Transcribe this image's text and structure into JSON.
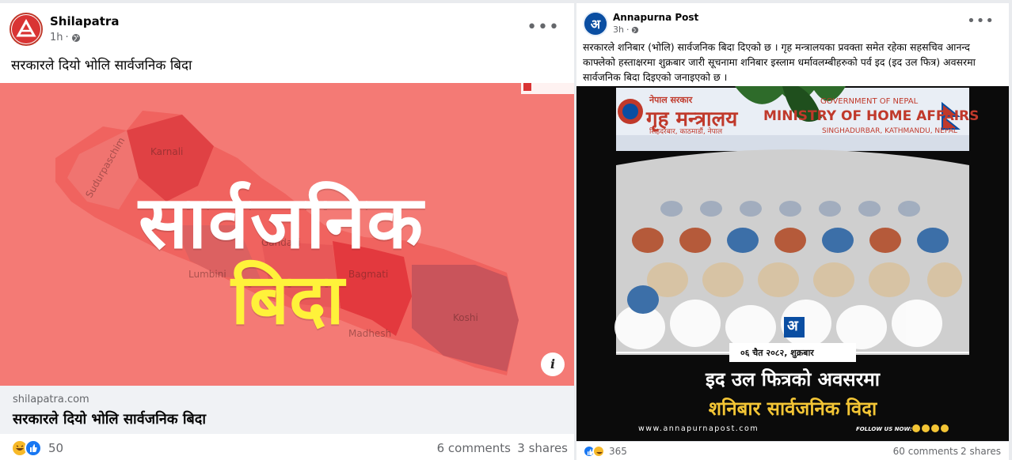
{
  "left_post": {
    "page_name": "Shilapatra",
    "time": "1h",
    "privacy_icon": "globe-icon",
    "text": "सरकारले दियो भोलि सार्वजनिक बिदा",
    "image": {
      "headline_line1": "सार्वजनिक",
      "headline_line2": "बिदा",
      "regions": [
        "Sudurpaschim",
        "Karnali",
        "Gandaki",
        "Lumbini",
        "Bagmati",
        "Madhesh",
        "Koshi"
      ],
      "info_label": "i"
    },
    "link_preview": {
      "domain": "shilapatra.com",
      "title": "सरकारले दियो भोलि सार्वजनिक बिदा"
    },
    "reactions": {
      "count": "50",
      "icons": [
        "haha-icon",
        "like-icon"
      ]
    },
    "comments": "6 comments",
    "shares": "3 shares",
    "colors": {
      "image_bg": "#f47a75",
      "map": "#e0484a",
      "title_yellow": "#fff23a"
    }
  },
  "right_post": {
    "page_name": "Annapurna Post",
    "time": "3h",
    "privacy_icon": "globe-icon",
    "text": "सरकारले शनिबार (भोलि) सार्वजनिक बिदा दिएको छ । गृह मन्त्रालयका प्रवक्ता समेत रहेका सहसचिव आनन्द काफ्लेको हस्ताक्षरमा शुक्रबार जारी सूचनामा शनिबार इस्लाम धर्मावलम्बीहरुको पर्व इद (इद उल फित्र) अवसरमा सार्वजनिक बिदा दिइएको जनाइएको छ ।",
    "image": {
      "ministry_devanagari": "गृह मन्त्रालय",
      "ministry_english": "MINISTRY OF HOME AFFAIRS",
      "gov_devanagari": "नेपाल सरकार",
      "gov_english": "GOVERNMENT OF NEPAL",
      "address_devanagari": "सिंहदरबार, काठमाडौं, नेपाल",
      "address_english": "SINGHADURBAR, KATHMANDU, NEPAL",
      "logo_letter": "अ",
      "date_label": "०६ चैत २०८२, शुक्रबार",
      "headline_line1": "इद उल फित्रको अवसरमा",
      "headline_line2": "शनिबार सार्वजनिक विदा",
      "website": "www.annapurnapost.com",
      "follow_label": "FOLLOW US NOW:"
    },
    "reactions": {
      "count": "365",
      "icons": [
        "like-icon",
        "haha-icon"
      ]
    },
    "comments": "60 comments",
    "shares": "2 shares",
    "colors": {
      "accent_blue": "#0a4ea2",
      "headline_gold": "#f3c535",
      "banner_red": "#c0392b"
    }
  }
}
